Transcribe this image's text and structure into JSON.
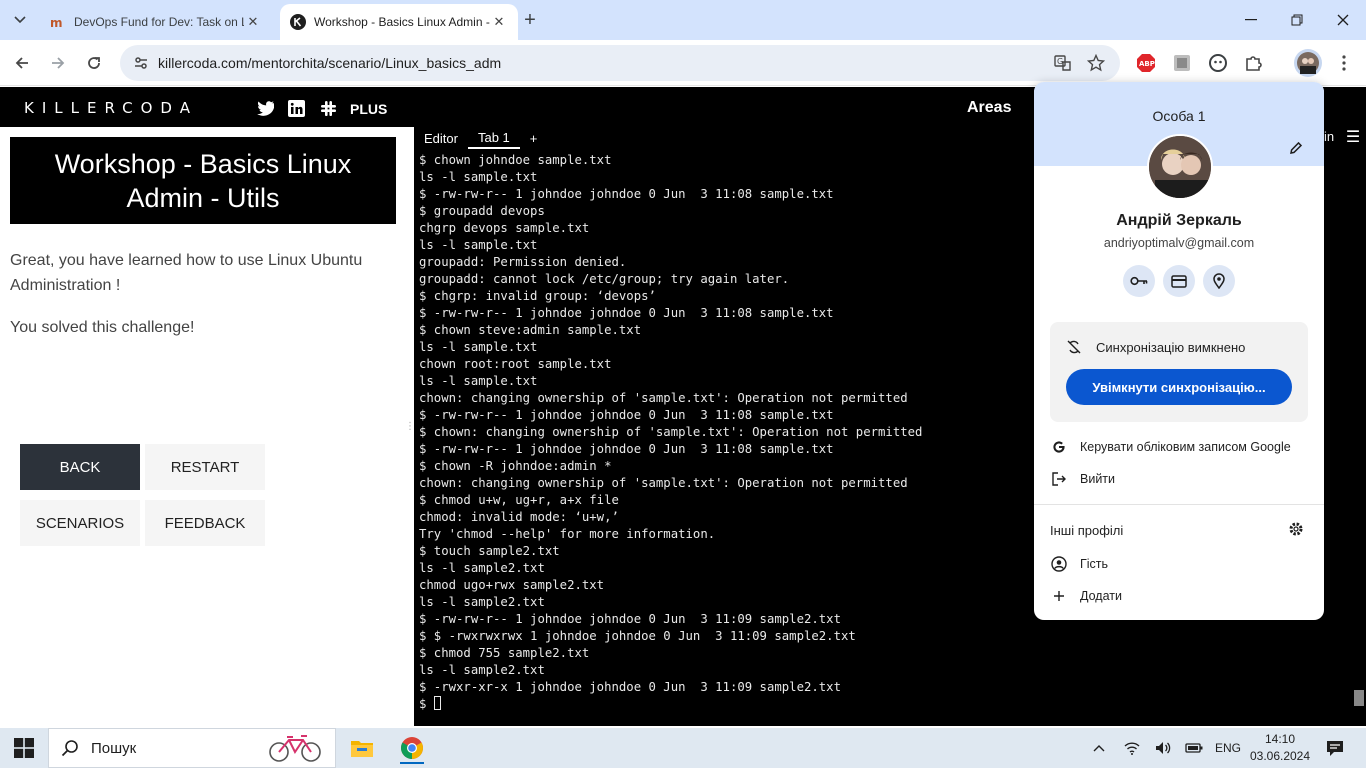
{
  "browser": {
    "tabs": [
      {
        "title": "DevOps Fund for Dev: Task on Linux",
        "active": false
      },
      {
        "title": "Workshop - Basics Linux Admin - Utils",
        "active": true
      }
    ],
    "url": "killercoda.com/mentorchita/scenario/Linux_basics_adm",
    "extension_abp": "ABP"
  },
  "site": {
    "logo": "KILLERCODA",
    "plus": "PLUS",
    "areas": "Areas",
    "login_partial": "in"
  },
  "scenario": {
    "title": "Workshop - Basics Linux Admin - Utils",
    "message1": "Great, you have learned how to use Linux Ubuntu Administration !",
    "message2": "You solved this challenge!",
    "buttons": {
      "back": "BACK",
      "restart": "RESTART",
      "scenarios": "SCENARIOS",
      "feedback": "FEEDBACK"
    }
  },
  "terminal": {
    "tabs": {
      "editor": "Editor",
      "tab1": "Tab 1",
      "add": "+"
    },
    "lines": [
      "$ chown johndoe sample.txt",
      "ls -l sample.txt",
      "$ -rw-rw-r-- 1 johndoe johndoe 0 Jun  3 11:08 sample.txt",
      "$ groupadd devops",
      "chgrp devops sample.txt",
      "ls -l sample.txt",
      "groupadd: Permission denied.",
      "groupadd: cannot lock /etc/group; try again later.",
      "$ chgrp: invalid group: ‘devops’",
      "$ -rw-rw-r-- 1 johndoe johndoe 0 Jun  3 11:08 sample.txt",
      "$ chown steve:admin sample.txt",
      "ls -l sample.txt",
      "chown root:root sample.txt",
      "ls -l sample.txt",
      "chown: changing ownership of 'sample.txt': Operation not permitted",
      "$ -rw-rw-r-- 1 johndoe johndoe 0 Jun  3 11:08 sample.txt",
      "$ chown: changing ownership of 'sample.txt': Operation not permitted",
      "$ -rw-rw-r-- 1 johndoe johndoe 0 Jun  3 11:08 sample.txt",
      "$ chown -R johndoe:admin *",
      "chown: changing ownership of 'sample.txt': Operation not permitted",
      "$ chmod u+w, ug+r, a+x file",
      "chmod: invalid mode: ‘u+w,’",
      "Try 'chmod --help' for more information.",
      "$ touch sample2.txt",
      "ls -l sample2.txt",
      "chmod ugo+rwx sample2.txt",
      "ls -l sample2.txt",
      "$ -rw-rw-r-- 1 johndoe johndoe 0 Jun  3 11:09 sample2.txt",
      "$ $ -rwxrwxrwx 1 johndoe johndoe 0 Jun  3 11:09 sample2.txt",
      "$ chmod 755 sample2.txt",
      "ls -l sample2.txt",
      "$ -rwxr-xr-x 1 johndoe johndoe 0 Jun  3 11:09 sample2.txt"
    ],
    "prompt": "$ "
  },
  "profile": {
    "persona": "Особа 1",
    "name": "Андрій Зеркаль",
    "email": "andriyoptimalv@gmail.com",
    "sync_status": "Синхронізацію вимкнено",
    "sync_button": "Увімкнути синхронізацію...",
    "manage_account": "Керувати обліковим записом Google",
    "sign_out": "Вийти",
    "other_profiles": "Інші профілі",
    "guest": "Гість",
    "add": "Додати"
  },
  "taskbar": {
    "search_placeholder": "Пошук",
    "language": "ENG",
    "time": "14:10",
    "date": "03.06.2024"
  },
  "colors": {
    "tabstrip": "#d3e3fd",
    "terminal_bg": "#000000",
    "sync_button": "#0b57d0",
    "back_button": "#2c323a"
  }
}
